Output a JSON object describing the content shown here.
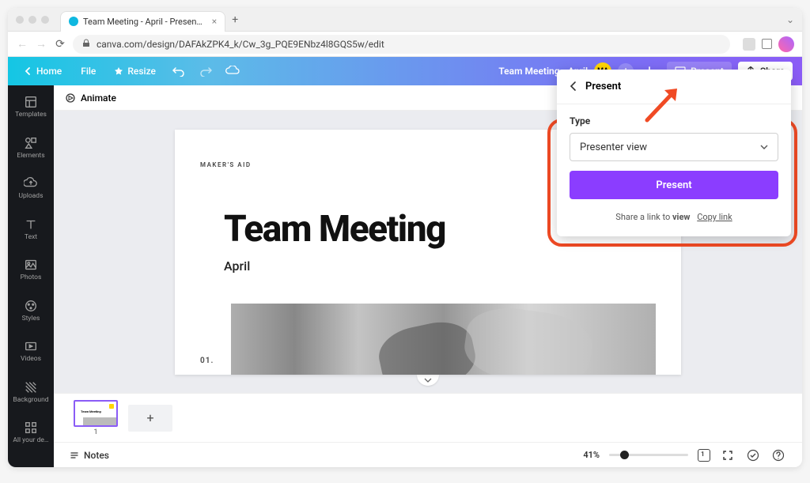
{
  "browser": {
    "tab_title": "Team Meeting - April - Presen…",
    "url": "canva.com/design/DAFAkZPK4_k/Cw_3g_PQE9ENbz4l8GQS5w/edit"
  },
  "toolbar": {
    "home": "Home",
    "file": "File",
    "resize": "Resize",
    "doc_title": "Team Meeting - April",
    "user_initials": "MA",
    "present_label": "Present",
    "share_label": "Share"
  },
  "leftbar": {
    "items": [
      {
        "label": "Templates"
      },
      {
        "label": "Elements"
      },
      {
        "label": "Uploads"
      },
      {
        "label": "Text"
      },
      {
        "label": "Photos"
      },
      {
        "label": "Styles"
      },
      {
        "label": "Videos"
      },
      {
        "label": "Background"
      },
      {
        "label": "All your de…"
      }
    ]
  },
  "subbar": {
    "animate": "Animate"
  },
  "slide": {
    "maker": "MAKER'S AID",
    "title": "Team Meeting",
    "subtitle": "April",
    "number": "01."
  },
  "thumbs": {
    "preview_text": "Team Meeting",
    "first_num": "1"
  },
  "footer": {
    "notes": "Notes",
    "zoom": "41%"
  },
  "panel": {
    "title": "Present",
    "type_label": "Type",
    "select_value": "Presenter view",
    "button": "Present",
    "share_prefix": "Share a link to ",
    "share_bold": "view",
    "copy": "Copy link"
  }
}
